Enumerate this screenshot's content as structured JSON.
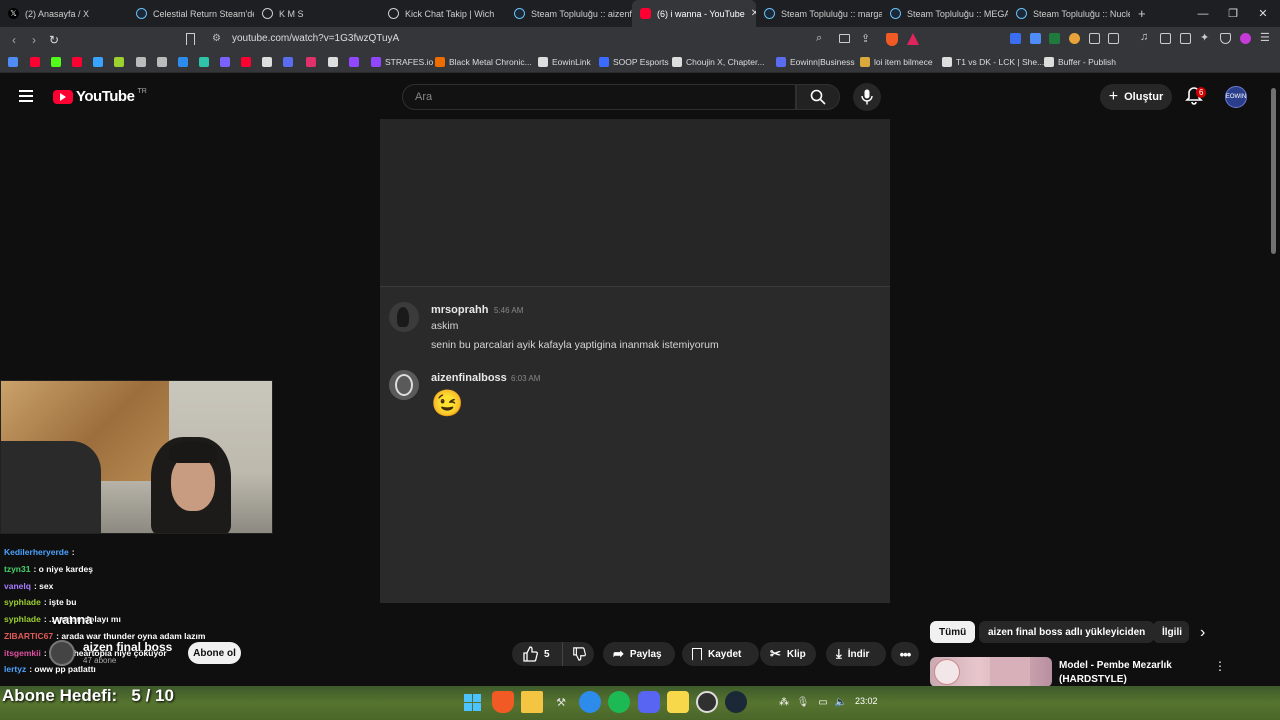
{
  "browser": {
    "tabs": [
      {
        "label": "(2) Anasayfa / X",
        "icon": "x-logo-icon",
        "active": false
      },
      {
        "label": "Celestial Return Steam'de",
        "icon": "steam-icon",
        "active": false
      },
      {
        "label": "K M S",
        "icon": "globe-icon",
        "active": false
      },
      {
        "label": "Kick Chat Takip | Wich",
        "icon": "globe-icon",
        "active": false
      },
      {
        "label": "Steam Topluluğu :: aizenfi",
        "icon": "steam-icon",
        "active": false
      },
      {
        "label": "(6) i wanna - YouTube",
        "icon": "youtube-icon",
        "active": true
      },
      {
        "label": "Steam Topluluğu :: marga",
        "icon": "steam-icon",
        "active": false
      },
      {
        "label": "Steam Topluluğu :: MEGA",
        "icon": "steam-icon",
        "active": false
      },
      {
        "label": "Steam Topluluğu :: Nuclea",
        "icon": "steam-icon",
        "active": false
      }
    ],
    "new_tab": "+",
    "url": "youtube.com/watch?v=1G3fwzQTuyA",
    "bookmarks": [
      {
        "label": "",
        "color": "#4f8cf7"
      },
      {
        "label": "",
        "color": "#ff0033"
      },
      {
        "label": "",
        "color": "#53fc18"
      },
      {
        "label": "",
        "color": "#ff0033"
      },
      {
        "label": "",
        "color": "#3aa3ff"
      },
      {
        "label": "",
        "color": "#9cd12f"
      },
      {
        "label": "",
        "color": "#bbbbbb"
      },
      {
        "label": "",
        "color": "#bbbbbb"
      },
      {
        "label": "",
        "color": "#2d8ceb"
      },
      {
        "label": "",
        "color": "#2dc4a8"
      },
      {
        "label": "",
        "color": "#7b61ff"
      },
      {
        "label": "",
        "color": "#ff0033"
      },
      {
        "label": "",
        "color": "#dddddd"
      },
      {
        "label": "",
        "color": "#5a6cf0"
      },
      {
        "label": "",
        "color": "#e1306c"
      },
      {
        "label": "",
        "color": "#dddddd"
      },
      {
        "label": "",
        "color": "#9146ff"
      },
      {
        "label": "STRAFES.io",
        "color": "#9146ff"
      },
      {
        "label": "Black Metal Chronic...",
        "color": "#ef6c00"
      },
      {
        "label": "EowinLink",
        "color": "#dddddd"
      },
      {
        "label": "SOOP Esports",
        "color": "#3b6cff"
      },
      {
        "label": "Choujin X, Chapter...",
        "color": "#dddddd"
      },
      {
        "label": "Eowinn|Business",
        "color": "#5a6cf0"
      },
      {
        "label": "loi item bilmece",
        "color": "#d9a93b"
      },
      {
        "label": "T1 vs DK - LCK | She...",
        "color": "#dddddd"
      },
      {
        "label": "Buffer - Publish",
        "color": "#dddddd"
      }
    ]
  },
  "youtube": {
    "logo_text": "YouTube",
    "logo_region": "TR",
    "search_placeholder": "Ara",
    "create_label": "Oluştur",
    "notification_count": "6",
    "avatar_text": "EOWIN"
  },
  "video": {
    "messages": [
      {
        "user": "mrsoprahh",
        "time": "5:46 AM",
        "lines": [
          "askim",
          "senin bu parcalari ayik kafayla yaptigina inanmak istemiyorum"
        ]
      },
      {
        "user": "aizenfinalboss",
        "time": "6:03 AM",
        "lines": [
          "😉"
        ]
      }
    ]
  },
  "stream_chat": [
    {
      "user": "Kedilerheryerde",
      "text": ":",
      "color": "#4aa3ff"
    },
    {
      "user": "tzyn31",
      "text": ": o niye kardeş",
      "color": "#46d46b"
    },
    {
      "user": "vanelq",
      "text": ": sex",
      "color": "#a77bff"
    },
    {
      "user": "syphlade",
      "text": ": işte bu",
      "color": "#9cd12f"
    },
    {
      "user": "syphlade",
      "text": ": ...undan dolayı mı",
      "color": "#9cd12f"
    },
    {
      "user": "ZIBARTIC67",
      "text": ": arada war thunder oyna adam lazım",
      "color": "#e05a5a"
    },
    {
      "user": "itsgemkii",
      "text": ": ya bu heartopia niye çöküyor",
      "color": "#e04fa0"
    },
    {
      "user": "lertyz",
      "text": ": oww pp patlattı",
      "color": "#4aa3ff"
    }
  ],
  "channel": {
    "name": "aizen final boss",
    "subscribers": "47 abone",
    "overlay_text": "wanna",
    "subscribe_label": "Abone ol"
  },
  "actions": {
    "likes": "5",
    "share": "Paylaş",
    "save": "Kaydet",
    "clip": "Klip",
    "download": "İndir"
  },
  "overlay": {
    "sub_goal": "Abone Hedefi:   5 / 10"
  },
  "sidebar": {
    "chips": [
      "Tümü",
      "aizen final boss adlı yükleyiciden",
      "İlgili"
    ],
    "recommended_title": "Model - Pembe Mezarlık (HARDSTYLE)"
  },
  "taskbar": {
    "time": "23:02"
  }
}
